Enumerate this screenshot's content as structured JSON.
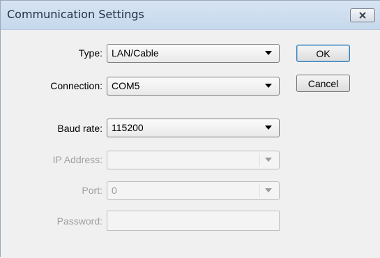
{
  "window": {
    "title": "Communication Settings",
    "close_icon": "close-x-icon"
  },
  "form": {
    "type": {
      "label": "Type:",
      "value": "LAN/Cable"
    },
    "connection": {
      "label": "Connection:",
      "value": "COM5"
    },
    "baud_rate": {
      "label": "Baud rate:",
      "value": "115200"
    },
    "ip_address": {
      "label": "IP Address:",
      "value": ""
    },
    "port": {
      "label": "Port:",
      "value": "0"
    },
    "password": {
      "label": "Password:",
      "value": ""
    }
  },
  "buttons": {
    "ok": "OK",
    "cancel": "Cancel"
  },
  "colors": {
    "titlebar": "#c6d8ec",
    "client": "#f0f0f0",
    "disabled_text": "#a0a0a0"
  }
}
